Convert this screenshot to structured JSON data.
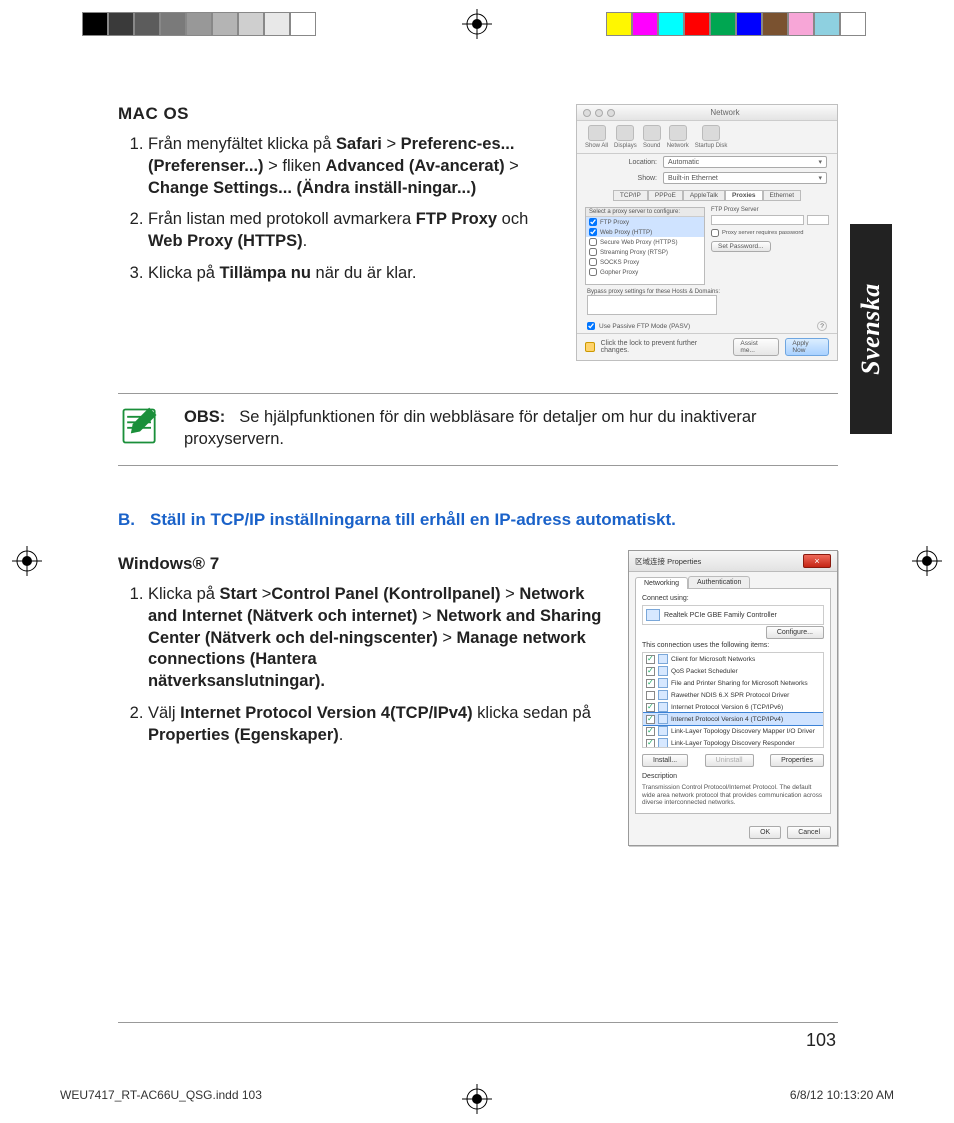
{
  "language_tab": "Svenska",
  "page_number": "103",
  "print_footer": {
    "file_ref": "WEU7417_RT-AC66U_QSG.indd   103",
    "datetime": "6/8/12   10:13:20 AM"
  },
  "section_a": {
    "heading": "MAC OS",
    "step1_parts": [
      "Från menyfältet klicka på ",
      "Safari",
      " > ",
      "Preferenc-­es... (Preferenser...)",
      " > fliken ",
      "Advanced (Av-­ancerat)",
      " > ",
      "Change  Settings... (Ändra inställ-­ningar...)"
    ],
    "step2_parts": [
      "Från listan med protokoll avmarkera ",
      "FTP Proxy",
      " och ",
      "Web Proxy (HTTPS)",
      "."
    ],
    "step3_parts": [
      "Klicka på ",
      "Tillämpa nu",
      " när du är klar."
    ]
  },
  "mac_dialog": {
    "title": "Network",
    "toolbar": [
      "Show All",
      "Displays",
      "Sound",
      "Network",
      "Startup Disk"
    ],
    "location_label": "Location:",
    "location_value": "Automatic",
    "show_label": "Show:",
    "show_value": "Built-in Ethernet",
    "tabs": [
      "TCP/IP",
      "PPPoE",
      "AppleTalk",
      "Proxies",
      "Ethernet"
    ],
    "active_tab": "Proxies",
    "proxy_list_header": "Select a proxy server to configure:",
    "proxy_items": [
      {
        "label": "FTP Proxy",
        "checked": true
      },
      {
        "label": "Web Proxy (HTTP)",
        "checked": true
      },
      {
        "label": "Secure Web Proxy (HTTPS)",
        "checked": false
      },
      {
        "label": "Streaming Proxy (RTSP)",
        "checked": false
      },
      {
        "label": "SOCKS Proxy",
        "checked": false
      },
      {
        "label": "Gopher Proxy",
        "checked": false
      }
    ],
    "ftp_server_label": "FTP Proxy Server",
    "proxy_requires_pw": "Proxy server requires password",
    "set_password": "Set Password...",
    "bypass_label": "Bypass proxy settings for these Hosts & Domains:",
    "passive_label": "Use Passive FTP Mode (PASV)",
    "lock_text": "Click the lock to prevent further changes.",
    "assist": "Assist me...",
    "apply": "Apply Now"
  },
  "note": {
    "label": "OBS:",
    "text": "Se hjälpfunktionen för din webbläsare för detaljer om hur du inaktiverar proxyservern."
  },
  "section_b": {
    "letter": "B.",
    "heading_text": "Ställ in TCP/IP inställningarna till erhåll en IP-adress automatiskt.",
    "win7_heading": "Windows® 7",
    "step1_parts": [
      "Klicka på ",
      "Start",
      " >",
      "Control Panel (Kontrollpanel)",
      " > ",
      "Network and Internet (Nätverk och internet)",
      " > ",
      "Network and Sharing Center (Nätverk och del-­ningscenter)",
      " > ",
      "Manage network connections (Hantera\nnätverksanslutningar)."
    ],
    "step2_parts": [
      "Välj ",
      "Internet Protocol Version 4(TCP/IPv4)",
      " klicka sedan på ",
      "Properties (Egenskaper)",
      "."
    ]
  },
  "win_dialog": {
    "title": "区域连接 Properties",
    "tabs": [
      "Networking",
      "Authentication"
    ],
    "active_tab": "Networking",
    "connect_using": "Connect using:",
    "nic": "Realtek PCIe GBE Family Controller",
    "configure": "Configure...",
    "uses_items_label": "This connection uses the following items:",
    "items": [
      {
        "label": "Client for Microsoft Networks",
        "checked": true
      },
      {
        "label": "QoS Packet Scheduler",
        "checked": true
      },
      {
        "label": "File and Printer Sharing for Microsoft Networks",
        "checked": true
      },
      {
        "label": "Rawether NDIS 6.X SPR Protocol Driver",
        "checked": false
      },
      {
        "label": "Internet Protocol Version 6 (TCP/IPv6)",
        "checked": true
      },
      {
        "label": "Internet Protocol Version 4 (TCP/IPv4)",
        "checked": true,
        "highlight": true
      },
      {
        "label": "Link-Layer Topology Discovery Mapper I/O Driver",
        "checked": true
      },
      {
        "label": "Link-Layer Topology Discovery Responder",
        "checked": true
      }
    ],
    "install": "Install...",
    "uninstall": "Uninstall",
    "properties": "Properties",
    "description_label": "Description",
    "description_text": "Transmission Control Protocol/Internet Protocol. The default wide area network protocol that provides communication across diverse interconnected networks.",
    "ok": "OK",
    "cancel": "Cancel"
  },
  "colorbar_left": [
    "#000",
    "#3a3a3a",
    "#5c5c5c",
    "#7a7a7a",
    "#989898",
    "#b4b4b4",
    "#cfcfcf",
    "#e8e8e8",
    "#fff"
  ],
  "colorbar_right": [
    "#fff700",
    "#ff00ff",
    "#00ffff",
    "#ff0000",
    "#00a651",
    "#0000ff",
    "#7a5230",
    "#f7a6d7",
    "#8ed0e0",
    "#fff"
  ]
}
